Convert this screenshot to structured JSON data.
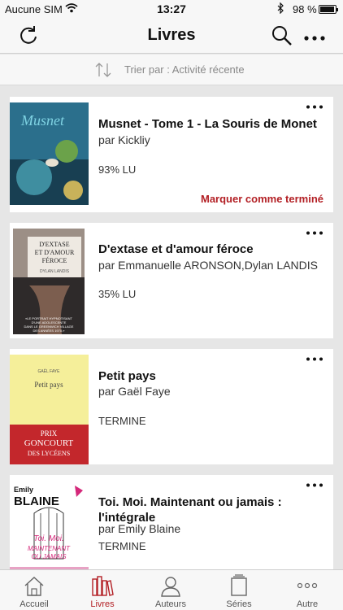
{
  "status_bar": {
    "carrier": "Aucune SIM",
    "time": "13:27",
    "battery": "98 %"
  },
  "header": {
    "title": "Livres"
  },
  "sort": {
    "label": "Trier par : Activité récente"
  },
  "books": [
    {
      "title": "Musnet - Tome 1 - La Souris de Monet",
      "author": "par Kickliy",
      "status": "93% LU",
      "action": "Marquer comme terminé",
      "cover_text": "Musnet",
      "cover_colors": [
        "#2b6f8c",
        "#183f52"
      ]
    },
    {
      "title": "D'extase et d'amour féroce",
      "author": "par Emmanuelle ARONSON,Dylan LANDIS",
      "status": "35% LU",
      "cover_title": "D'EXTASE ET D'AMOUR FÉROCE",
      "cover_author": "DYLAN LANDIS",
      "cover_quote": "«LE PORTRAIT HYPNOTISANT D'UNE ADOLESCENTE DANS LE GREENWICH VILLAGE DES ANNÉES 1970.»",
      "cover_colors": [
        "#5a4d48",
        "#2e2a2a"
      ]
    },
    {
      "title": "Petit pays",
      "author": "par Gaël Faye",
      "status": "TERMINE",
      "cover_author": "GAËL FAYE",
      "cover_title": "Petit pays",
      "cover_band": "PRIX GONCOURT DES LYCÉENS",
      "cover_colors": [
        "#f5ef9a",
        "#c3272c"
      ]
    },
    {
      "title": "Toi. Moi. Maintenant ou jamais : l'intégrale",
      "author": "par Emily Blaine",
      "status": "TERMINE",
      "cover_author": "Emily BLAINE",
      "cover_title": "Toi. Moi. MAINTENANT OU JAMAIS",
      "cover_colors": [
        "#ffffff",
        "#d4287a"
      ]
    }
  ],
  "tabs": [
    {
      "label": "Accueil",
      "active": false
    },
    {
      "label": "Livres",
      "active": true
    },
    {
      "label": "Auteurs",
      "active": false
    },
    {
      "label": "Séries",
      "active": false
    },
    {
      "label": "Autre",
      "active": false
    }
  ],
  "colors": {
    "accent": "#b32025",
    "background": "#e6e6e6",
    "bar": "#f7f7f7"
  }
}
